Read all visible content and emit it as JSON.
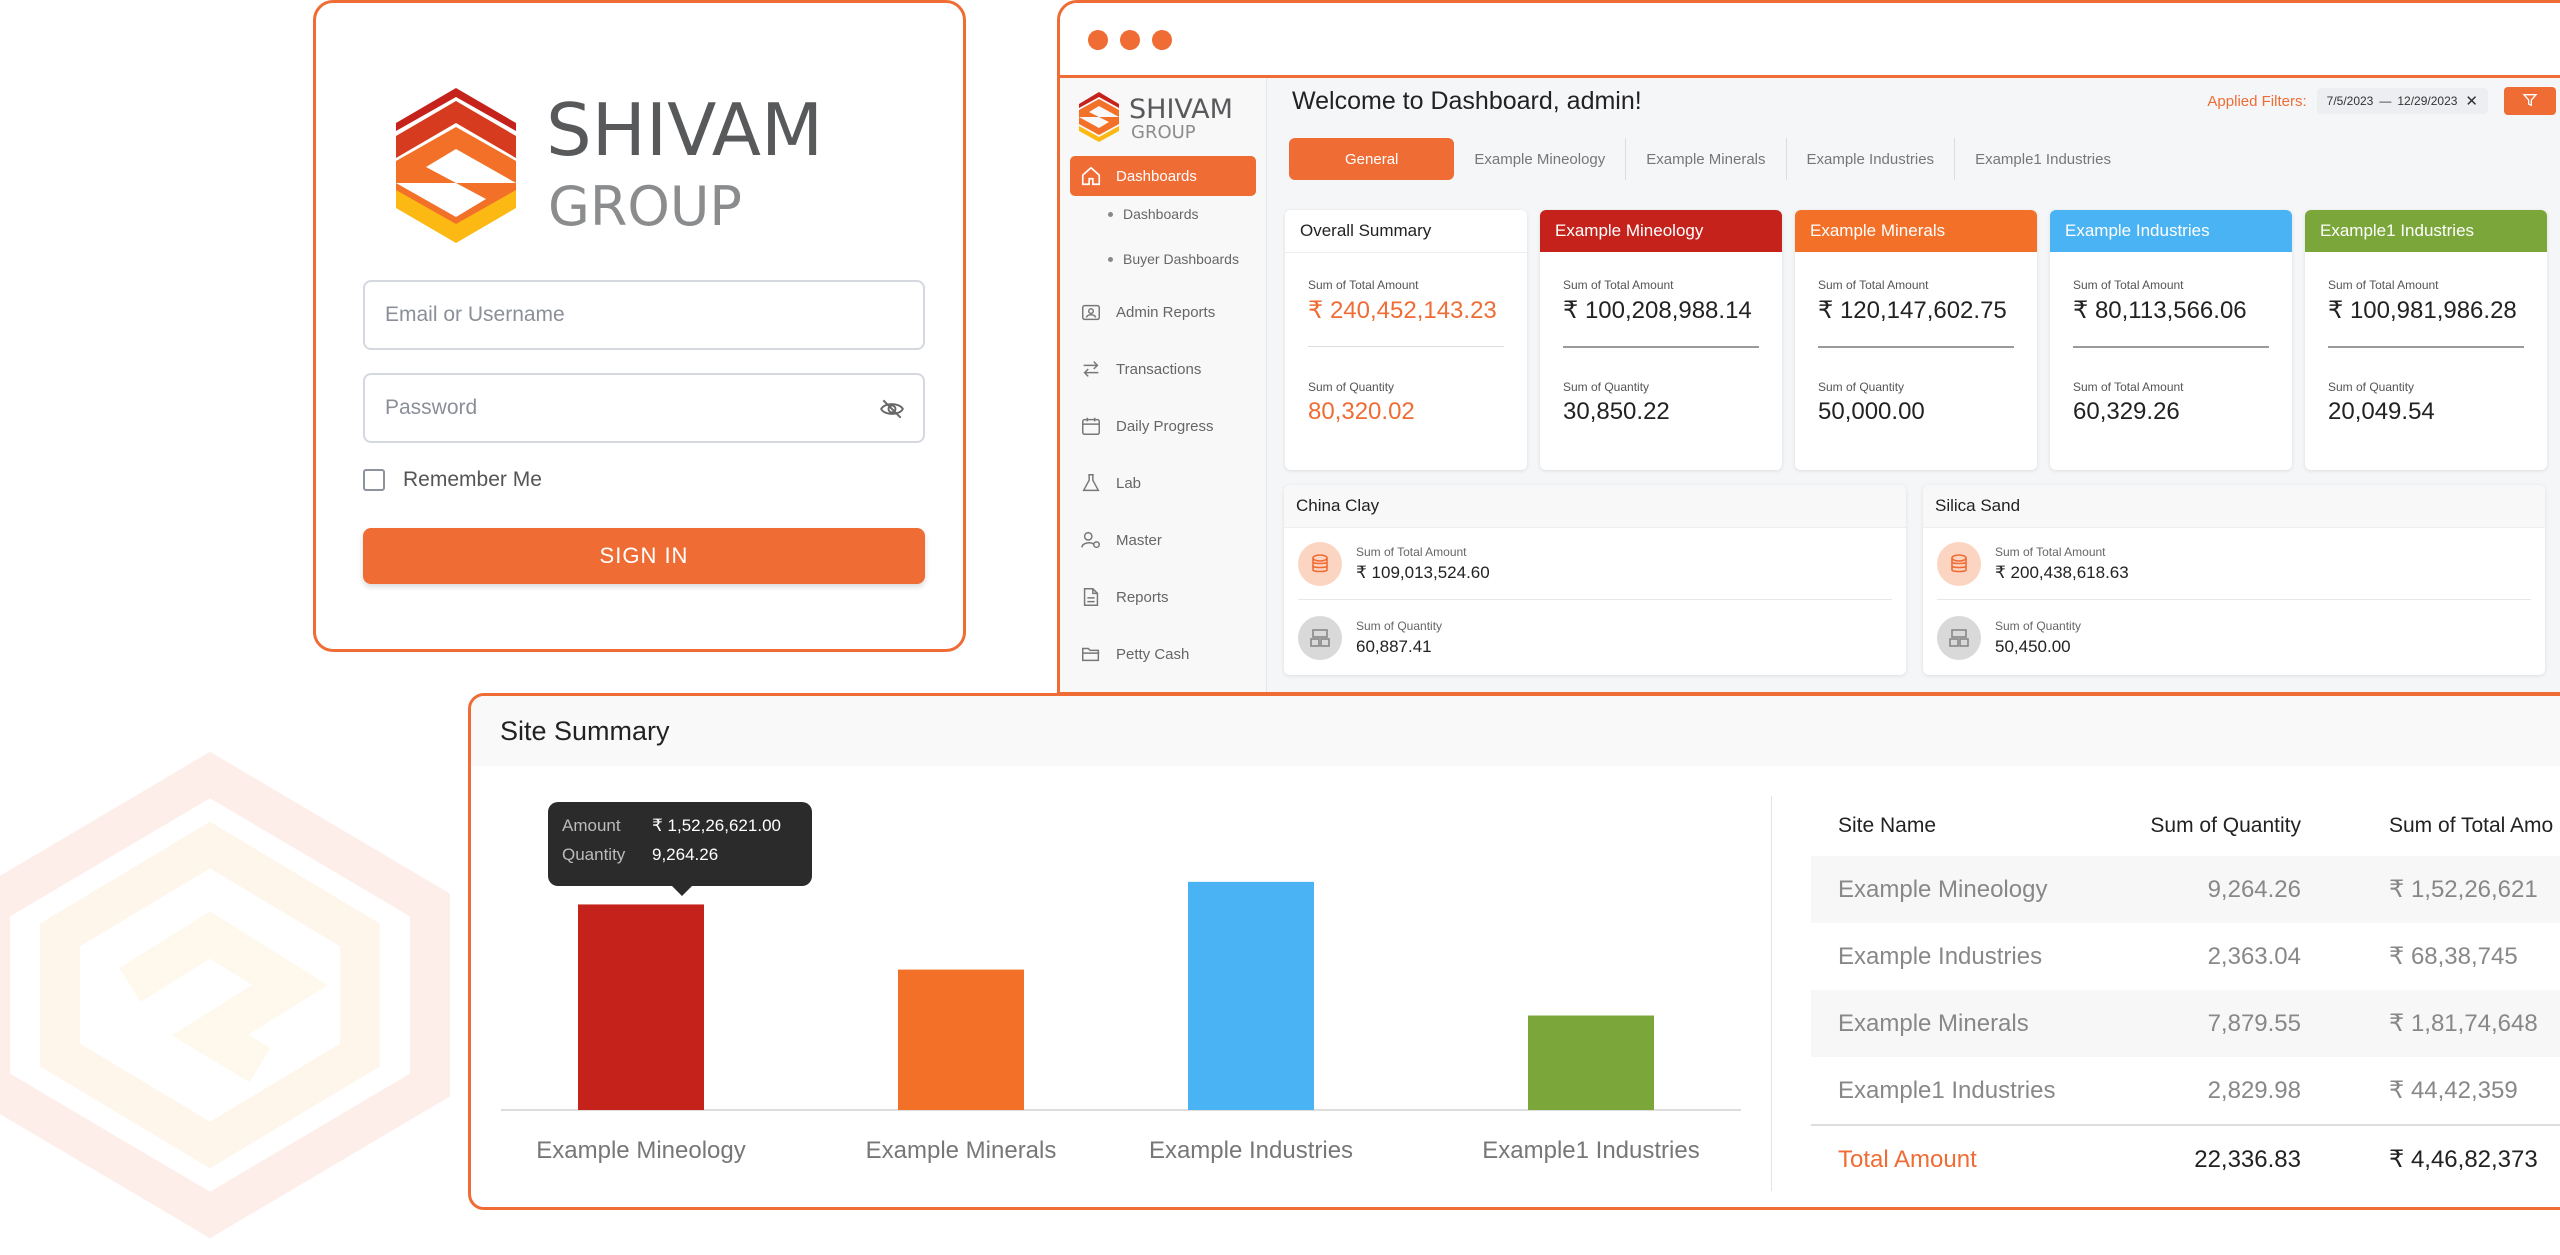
{
  "colors": {
    "accent": "#ef6c35",
    "mineology": "#c4221b",
    "minerals": "#f37029",
    "industries": "#4ab3f4",
    "industries1": "#7ba73a"
  },
  "brand": {
    "name": "SHIVAM",
    "sub": "GROUP"
  },
  "login": {
    "email_placeholder": "Email or Username",
    "password_placeholder": "Password",
    "remember_label": "Remember Me",
    "signin_label": "SIGN IN"
  },
  "dashboard": {
    "welcome": "Welcome to Dashboard, admin!",
    "filters_label": "Applied Filters:",
    "date_from": "7/5/2023",
    "date_to": "12/29/2023",
    "sidebar": {
      "dashboards": "Dashboards",
      "sub_dashboards": "Dashboards",
      "sub_buyer": "Buyer Dashboards",
      "admin_reports": "Admin Reports",
      "transactions": "Transactions",
      "daily_progress": "Daily Progress",
      "lab": "Lab",
      "master": "Master",
      "reports": "Reports",
      "petty_cash": "Petty Cash"
    },
    "tabs": [
      "General",
      "Example Mineology",
      "Example Minerals",
      "Example Industries",
      "Example1 Industries"
    ],
    "cards": [
      {
        "title": "Overall Summary",
        "lbl1": "Sum of Total Amount",
        "val1": "₹ 240,452,143.23",
        "lbl2": "Sum of Quantity",
        "val2": "80,320.02"
      },
      {
        "title": "Example Mineology",
        "lbl1": "Sum of Total Amount",
        "val1": "₹  100,208,988.14",
        "lbl2": "Sum of Quantity",
        "val2": "30,850.22"
      },
      {
        "title": "Example Minerals",
        "lbl1": "Sum of Total Amount",
        "val1": "₹ 120,147,602.75",
        "lbl2": "Sum of Quantity",
        "val2": "50,000.00"
      },
      {
        "title": "Example Industries",
        "lbl1": "Sum of Total Amount",
        "val1": "₹ 80,113,566.06",
        "lbl2": "Sum of Total Amount",
        "val2": "60,329.26"
      },
      {
        "title": "Example1 Industries",
        "lbl1": "Sum of Total Amount",
        "val1": "₹ 100,981,986.28",
        "lbl2": "Sum of Quantity",
        "val2": "20,049.54"
      }
    ],
    "materials": [
      {
        "title": "China Clay",
        "lbl1": "Sum of Total Amount",
        "val1": "₹ 109,013,524.60",
        "lbl2": "Sum of Quantity",
        "val2": "60,887.41"
      },
      {
        "title": "Silica Sand",
        "lbl1": "Sum of Total Amount",
        "val1": "₹ 200,438,618.63",
        "lbl2": "Sum of Quantity",
        "val2": "50,450.00"
      }
    ]
  },
  "site_summary": {
    "title": "Site Summary",
    "tooltip": {
      "amount_label": "Amount",
      "amount_value": "₹ 1,52,26,621.00",
      "quantity_label": "Quantity",
      "quantity_value": "9,264.26"
    },
    "table": {
      "headers": [
        "Site Name",
        "Sum of Quantity",
        "Sum of Total Amo"
      ],
      "rows": [
        [
          "Example Mineology",
          "9,264.26",
          "₹ 1,52,26,621"
        ],
        [
          "Example Industries",
          "2,363.04",
          "₹ 68,38,745"
        ],
        [
          "Example Minerals",
          "7,879.55",
          "₹ 1,81,74,648"
        ],
        [
          "Example1 Industries",
          "2,829.98",
          "₹ 44,42,359"
        ]
      ],
      "total": [
        "Total Amount",
        "22,336.83",
        "₹ 4,46,82,373"
      ]
    }
  },
  "chart_data": {
    "type": "bar",
    "categories": [
      "Example Mineology",
      "Example Minerals",
      "Example Industries",
      "Example1 Industries"
    ],
    "values": [
      15226621,
      10400000,
      16900000,
      7000000
    ],
    "ylim": [
      0,
      20000000
    ],
    "grid": false,
    "colors": [
      "#c4221b",
      "#f37029",
      "#4ab3f4",
      "#7ba73a"
    ]
  }
}
